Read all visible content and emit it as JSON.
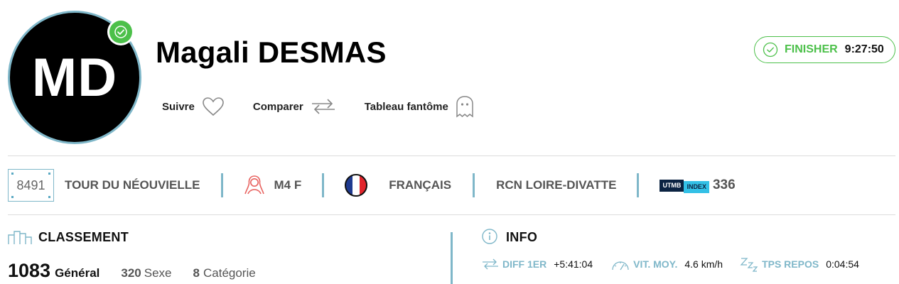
{
  "profile": {
    "initials": "MD",
    "name": "Magali DESMAS"
  },
  "actions": {
    "follow_label": "Suivre",
    "compare_label": "Comparer",
    "ghost_label": "Tableau fantôme"
  },
  "status": {
    "label": "FINISHER",
    "time": "9:27:50",
    "color": "#4cc04a"
  },
  "infobar": {
    "bib": "8491",
    "race": "TOUR DU NÉOUVIELLE",
    "category": "M4 F",
    "nationality": "FRANÇAIS",
    "club": "RCN LOIRE-DIVATTE",
    "utmb_logo_a": "UTMB",
    "utmb_logo_b": "INDEX",
    "utmb_index": "336"
  },
  "classement": {
    "title": "CLASSEMENT",
    "general_value": "1083",
    "general_label": "Général",
    "sexe_value": "320",
    "sexe_label": "Sexe",
    "categorie_value": "8",
    "categorie_label": "Catégorie"
  },
  "info": {
    "title": "INFO",
    "diff_label": "DIFF 1ER",
    "diff_value": "+5:41:04",
    "speed_label": "VIT. MOY.",
    "speed_value": "4.6 km/h",
    "rest_label": "TPS REPOS",
    "rest_value": "0:04:54"
  },
  "colors": {
    "accent": "#7fb7c9",
    "finisher": "#4cc04a",
    "category_icon": "#e8625f"
  }
}
